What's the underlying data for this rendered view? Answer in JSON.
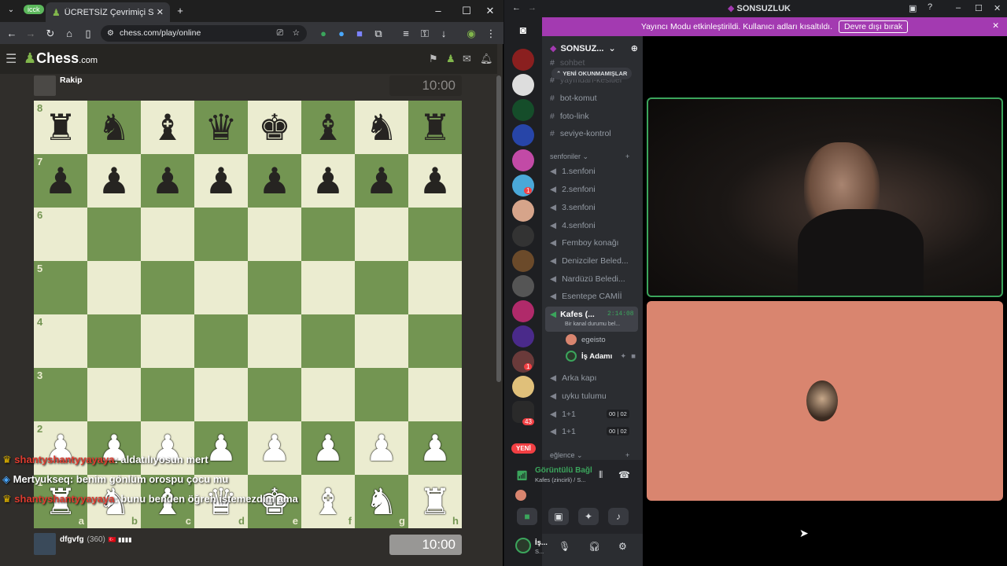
{
  "browser": {
    "tab_title": "ÜCRETSİZ Çevrimiçi Satranç Oy",
    "url": "chess.com/play/online",
    "chess_logo": "Chess",
    "chess_logo_suffix": ".com",
    "badge": "icck"
  },
  "game": {
    "opponent_name": "Rakip",
    "opponent_clock": "10:00",
    "player_name": "dfgvfg",
    "player_rating": "(360)",
    "player_flags": "🇹🇷 ▮▮▮▮",
    "player_clock": "10:00",
    "ranks": [
      "8",
      "7",
      "6",
      "5",
      "4",
      "3",
      "2",
      "1"
    ],
    "files": [
      "a",
      "b",
      "c",
      "d",
      "e",
      "f",
      "g",
      "h"
    ],
    "position": [
      [
        "♜",
        "♞",
        "♝",
        "♛",
        "♚",
        "♝",
        "♞",
        "♜"
      ],
      [
        "♟",
        "♟",
        "♟",
        "♟",
        "♟",
        "♟",
        "♟",
        "♟"
      ],
      [
        "",
        "",
        "",
        "",
        "",
        "",
        "",
        ""
      ],
      [
        "",
        "",
        "",
        "",
        "",
        "",
        "",
        ""
      ],
      [
        "",
        "",
        "",
        "",
        "",
        "",
        "",
        ""
      ],
      [
        "",
        "",
        "",
        "",
        "",
        "",
        "",
        ""
      ],
      [
        "♟",
        "♟",
        "♟",
        "♟",
        "♟",
        "♟",
        "♟",
        "♟"
      ],
      [
        "♜",
        "♞",
        "♝",
        "♛",
        "♚",
        "♝",
        "♞",
        "♜"
      ]
    ]
  },
  "chat_overlay": [
    {
      "user": "shantyshantyyayaya",
      "message": ": aldatılıyosun mert",
      "color": "#e03b2f"
    },
    {
      "user": "Mertyukseq",
      "message": ": benim gönlüm orospu çocu mu",
      "color": "#ffffff"
    },
    {
      "user": "shantyshantyyayaya",
      "message": ": bunu benden öğren istemezdim ama",
      "color": "#e03b2f"
    }
  ],
  "discord": {
    "window_title": "SONSUZLUK",
    "banner_text": "Yayıncı Modu etkinleştirildi. Kullanıcı adları kısaltıldı.",
    "banner_button": "Devre dışı bırak",
    "server_name": "SONSUZ...",
    "unread_pill": "YENİ OKUNMAMIŞLAR",
    "text_channels": [
      "sohbet",
      "yayından-kesitler",
      "bot-komut",
      "foto-link",
      "seviye-kontrol"
    ],
    "voice_category": "senfoniler",
    "voice_channels": [
      "1.senfoni",
      "2.senfoni",
      "3.senfoni",
      "4.senfoni",
      "Femboy konağı",
      "Denizciler Beled...",
      "Nardüzü Beledi...",
      "Esentepe CAMİİ"
    ],
    "active_channel": {
      "name": "Kafes (...",
      "timer": "2:14:08",
      "status": "Bir kanal durumu bel..."
    },
    "members": [
      "egeisto",
      "İş Adamı"
    ],
    "more_channels": [
      {
        "name": "Arka kapı",
        "count_a": "",
        "count_b": ""
      },
      {
        "name": "uyku tulumu",
        "count_a": "",
        "count_b": ""
      },
      {
        "name": "1+1",
        "count_a": "00",
        "count_b": "02"
      },
      {
        "name": "1+1",
        "count_a": "00",
        "count_b": "02"
      }
    ],
    "category2": "eğlence",
    "new_pill": "YENİ",
    "guild_badges": [
      "1",
      "1",
      "43"
    ],
    "voice_status": "Görüntülü Bağl",
    "voice_sub": "Kafes (zincirli) / S...",
    "user_name": "İş...",
    "user_sub": "S..."
  },
  "colors": {
    "chess_light": "#ebecd0",
    "chess_dark": "#739552",
    "discord_banner": "#a33ab1",
    "voice_green": "#3ba55c"
  }
}
